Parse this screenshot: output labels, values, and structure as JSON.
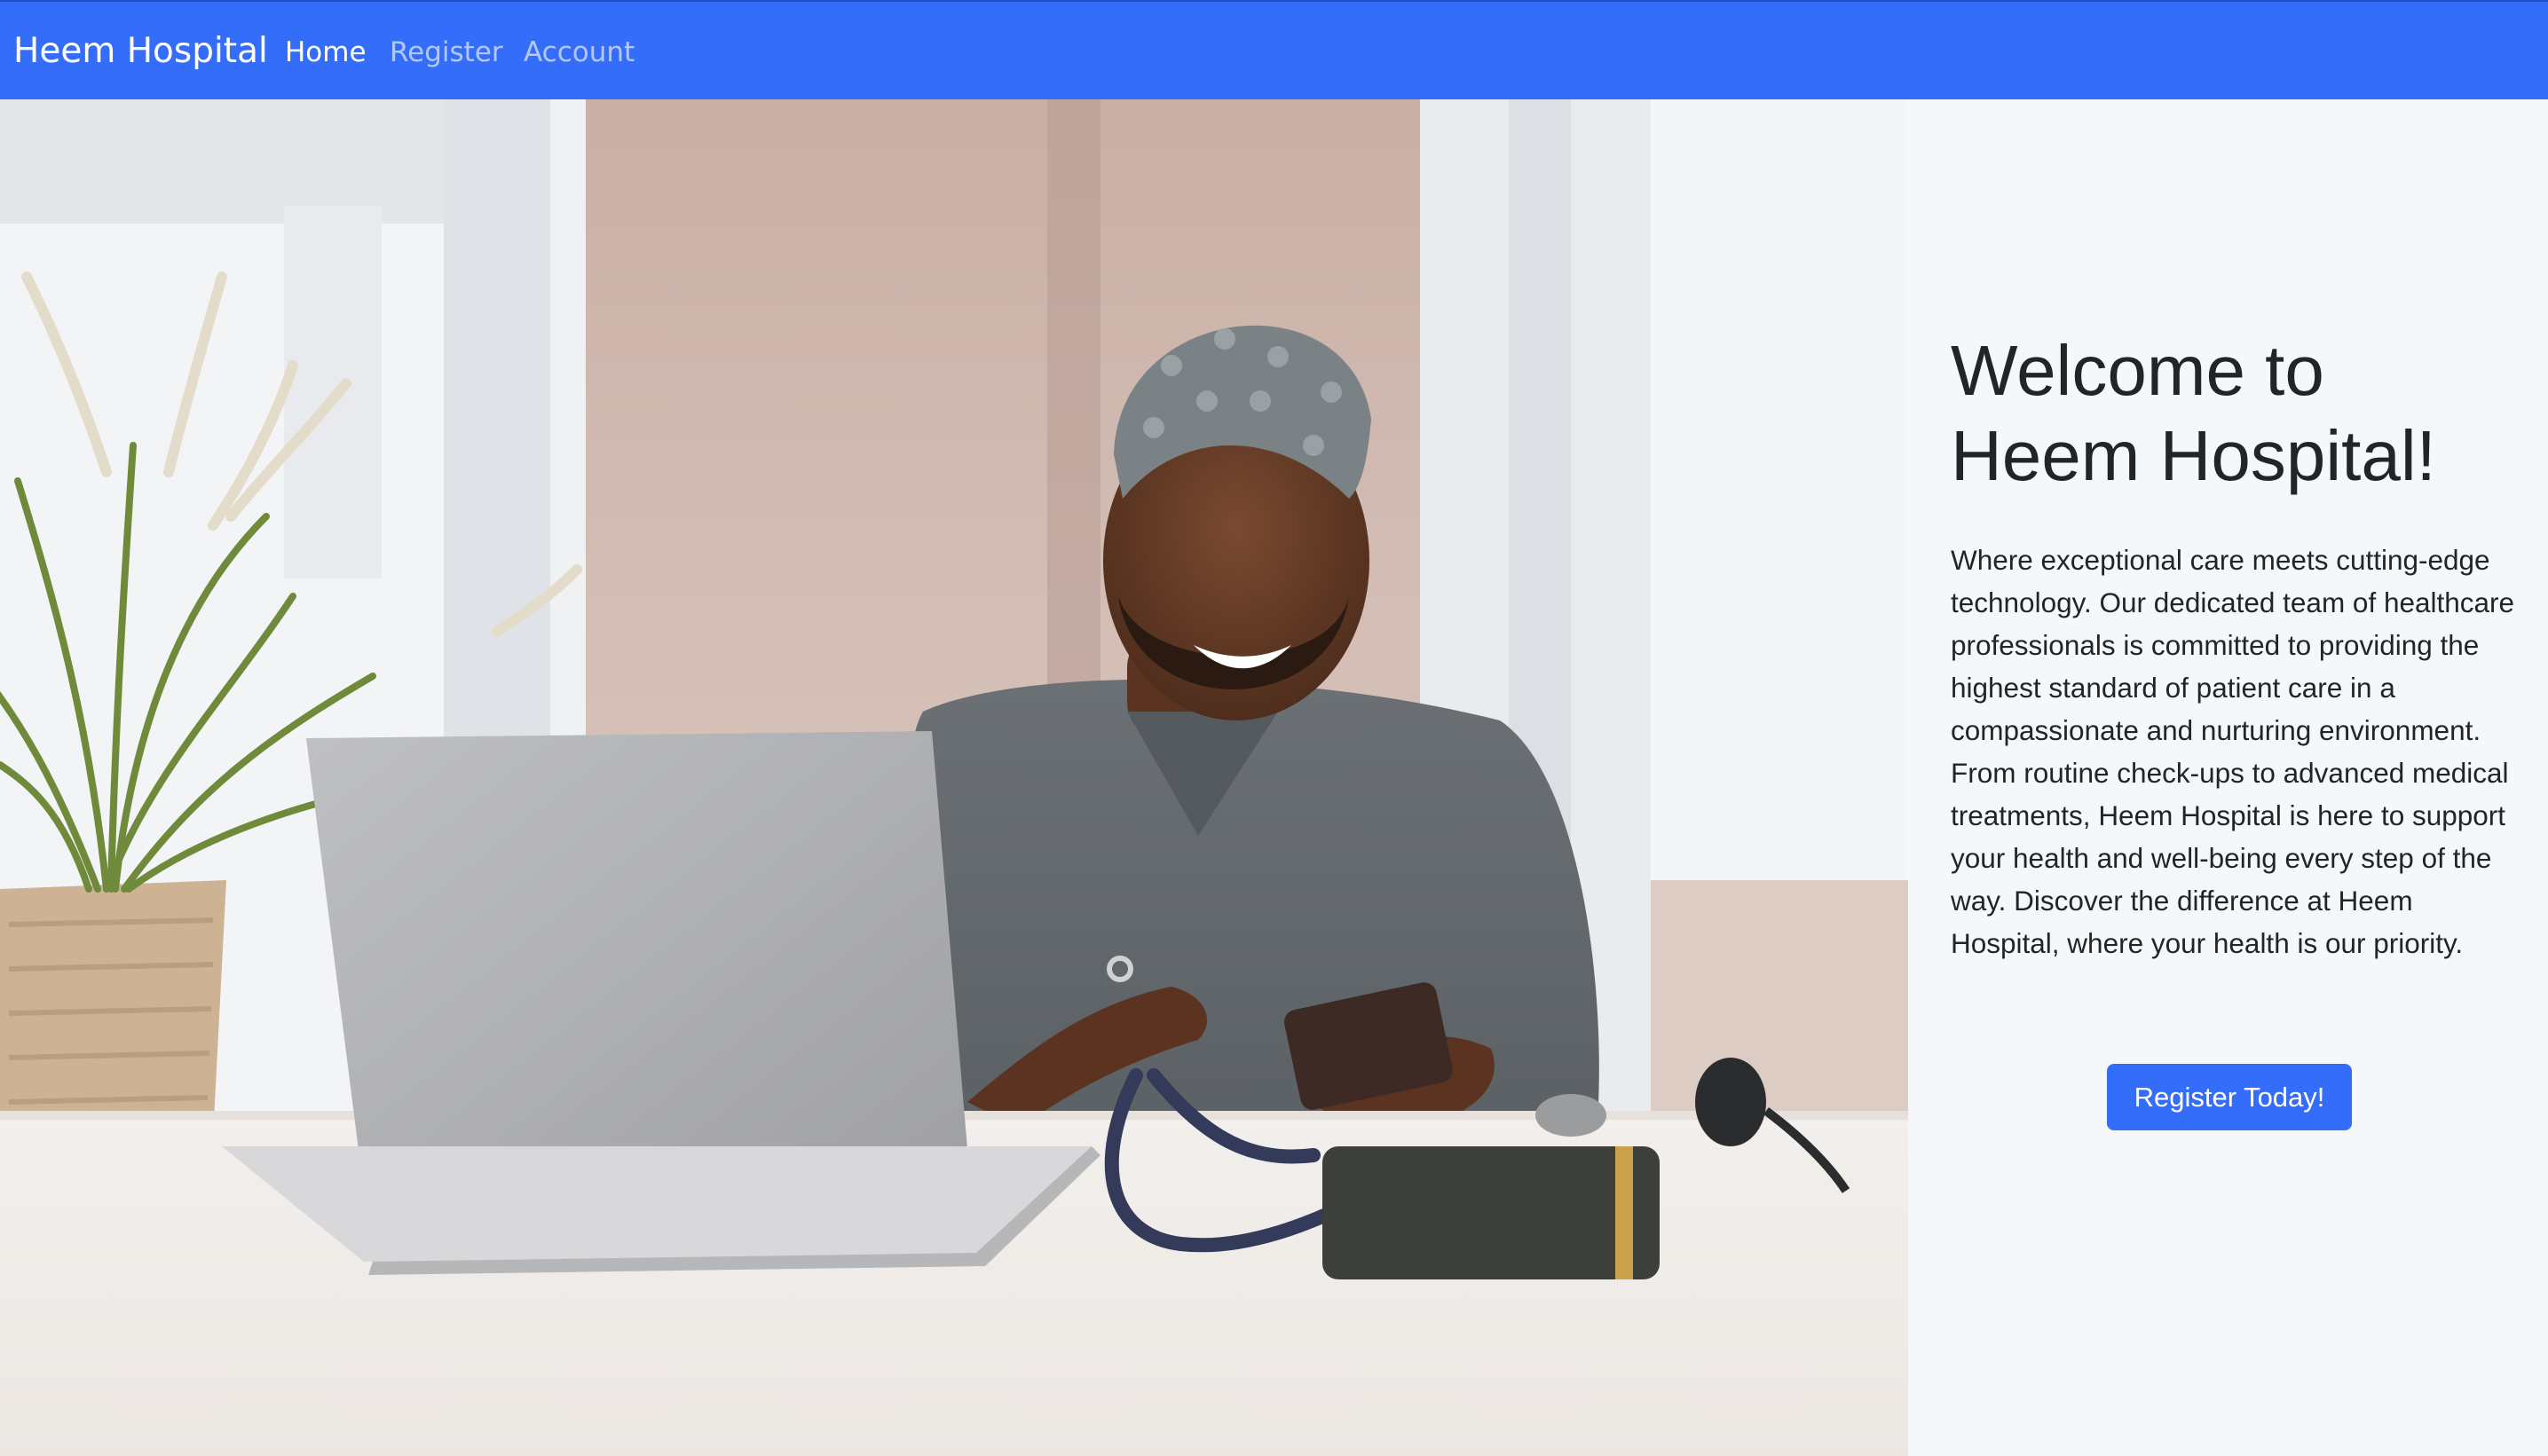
{
  "navbar": {
    "brand": "Heem Hospital",
    "links": [
      {
        "label": "Home",
        "active": true
      },
      {
        "label": "Register",
        "active": false
      },
      {
        "label": "Account",
        "active": false
      }
    ],
    "background_color": "#356dfb"
  },
  "carousel": {
    "slide_count": 3,
    "active_slide": 1,
    "image_description_icon": "doctor-with-phone-and-laptop-photo"
  },
  "welcome": {
    "title": "Welcome to Heem Hospital!",
    "text": "Where exceptional care meets cutting-edge technology. Our dedicated team of healthcare professionals is committed to providing the highest standard of patient care in a compassionate and nurturing environment. From routine check-ups to advanced medical treatments, Heem Hospital is here to support your health and well-being every step of the way. Discover the difference at Heem Hospital, where your health is our priority.",
    "button_label": "Register Today!"
  },
  "colors": {
    "primary": "#356dfb",
    "text": "#212529",
    "panel_background": "#f6f7f9"
  }
}
